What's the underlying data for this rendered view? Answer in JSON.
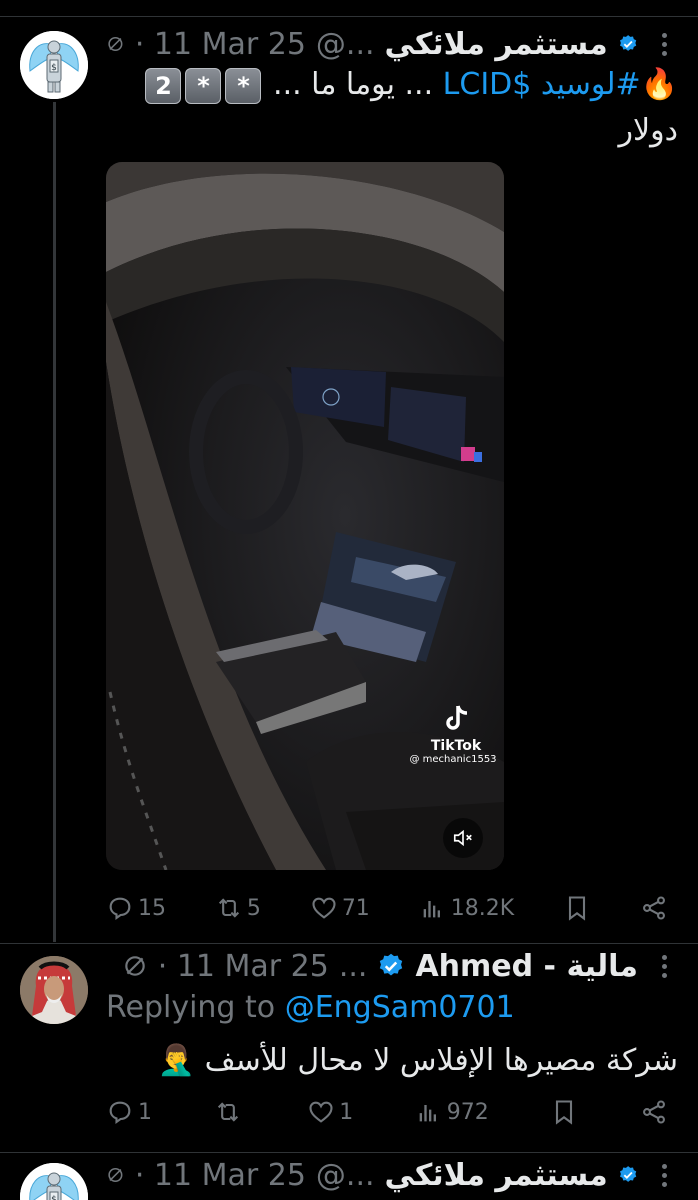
{
  "tweet1": {
    "name": "مستثمر ملائكي",
    "handle": "@...",
    "date": "· 11 Mar 25",
    "text_prefix": "🔥",
    "hashtag": "#لوسيد",
    "cashtag": "$LCID",
    "text_mid": "... يوما ما ...",
    "keys": [
      "2",
      "*",
      "*"
    ],
    "text_line2": "دولار",
    "video": {
      "tiktok_label": "TikTok",
      "tiktok_user": "@ mechanic1553"
    },
    "stats": {
      "replies": "15",
      "reposts": "5",
      "likes": "71",
      "views": "18.2K"
    }
  },
  "tweet2": {
    "name": "Ahmed - مالية",
    "handle": "...",
    "date": "· 11 Mar 25",
    "replying_prefix": "Replying to",
    "replying_to": "@EngSam0701",
    "text": "شركة مصيرها الإفلاس لا محال للأسف 🤦‍♂️",
    "stats": {
      "replies": "1",
      "reposts": "",
      "likes": "1",
      "views": "972"
    }
  },
  "tweet3": {
    "name": "مستثمر ملائكي",
    "handle": "@...",
    "date": "· 11 Mar 25"
  },
  "colors": {
    "accent": "#1d9bf0",
    "muted": "#71767b",
    "bg": "#000000"
  }
}
